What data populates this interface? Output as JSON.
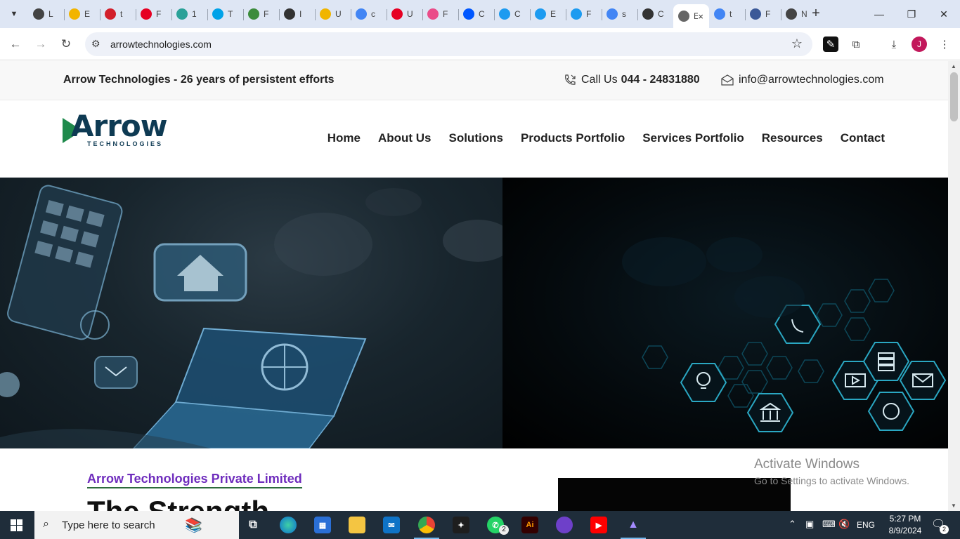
{
  "browser": {
    "tabs": [
      {
        "icon": "openai-icon",
        "label": "L",
        "color": "#444444"
      },
      {
        "icon": "emoji-icon",
        "label": "E",
        "color": "#f2b400"
      },
      {
        "icon": "k-icon",
        "label": "t",
        "color": "#d21f2b"
      },
      {
        "icon": "pinterest-icon",
        "label": "F",
        "color": "#e60023"
      },
      {
        "icon": "d-icon",
        "label": "1",
        "color": "#2aa198"
      },
      {
        "icon": "t-icon",
        "label": "T",
        "color": "#00a2e8"
      },
      {
        "icon": "robot-icon",
        "label": "F",
        "color": "#3c8c3c"
      },
      {
        "icon": "openai-icon",
        "label": "I",
        "color": "#333333"
      },
      {
        "icon": "mortarboard-icon",
        "label": "U",
        "color": "#f0b500"
      },
      {
        "icon": "google-icon",
        "label": "c",
        "color": "#4285f4"
      },
      {
        "icon": "pinterest-icon",
        "label": "U",
        "color": "#e60023"
      },
      {
        "icon": "dribbble-icon",
        "label": "F",
        "color": "#ea4c89"
      },
      {
        "icon": "behance-icon",
        "label": "C",
        "color": "#0057ff"
      },
      {
        "icon": "w-icon",
        "label": "C",
        "color": "#1d9bf0"
      },
      {
        "icon": "w-icon",
        "label": "E",
        "color": "#1d9bf0"
      },
      {
        "icon": "w-icon",
        "label": "F",
        "color": "#1d9bf0"
      },
      {
        "icon": "google-icon",
        "label": "s",
        "color": "#4285f4"
      },
      {
        "icon": "owl-icon",
        "label": "C",
        "color": "#333333"
      },
      {
        "icon": "globe-icon",
        "label": "E",
        "color": "#666666",
        "active": true
      },
      {
        "icon": "google-icon",
        "label": "t",
        "color": "#4285f4"
      },
      {
        "icon": "bird-icon",
        "label": "F",
        "color": "#3b5998"
      },
      {
        "icon": "openai-icon",
        "label": "N",
        "color": "#444444"
      }
    ],
    "close_tab": "×",
    "new_tab": "+",
    "window_controls": {
      "minimize": "—",
      "restore": "❐",
      "close": "✕"
    },
    "url": "arrowtechnologies.com",
    "profile_initial": "J"
  },
  "site": {
    "tagline": "Arrow Technologies - 26 years of persistent efforts",
    "call_label": "Call Us",
    "phone": "044 - 24831880",
    "email": "info@arrowtechnologies.com",
    "logo_word": "Arrow",
    "logo_sub": "TECHNOLOGIES",
    "nav": [
      "Home",
      "About Us",
      "Solutions",
      "Products Portfolio",
      "Services Portfolio",
      "Resources",
      "Contact"
    ],
    "company_link": "Arrow Technologies Private Limited",
    "headline": "The Strength"
  },
  "watermark": {
    "line1": "Activate Windows",
    "line2": "Go to Settings to activate Windows."
  },
  "taskbar": {
    "search_placeholder": "Type here to search",
    "language": "ENG",
    "time": "5:27 PM",
    "date": "8/9/2024",
    "whatsapp_badge": "2",
    "notification_badge": "2"
  }
}
